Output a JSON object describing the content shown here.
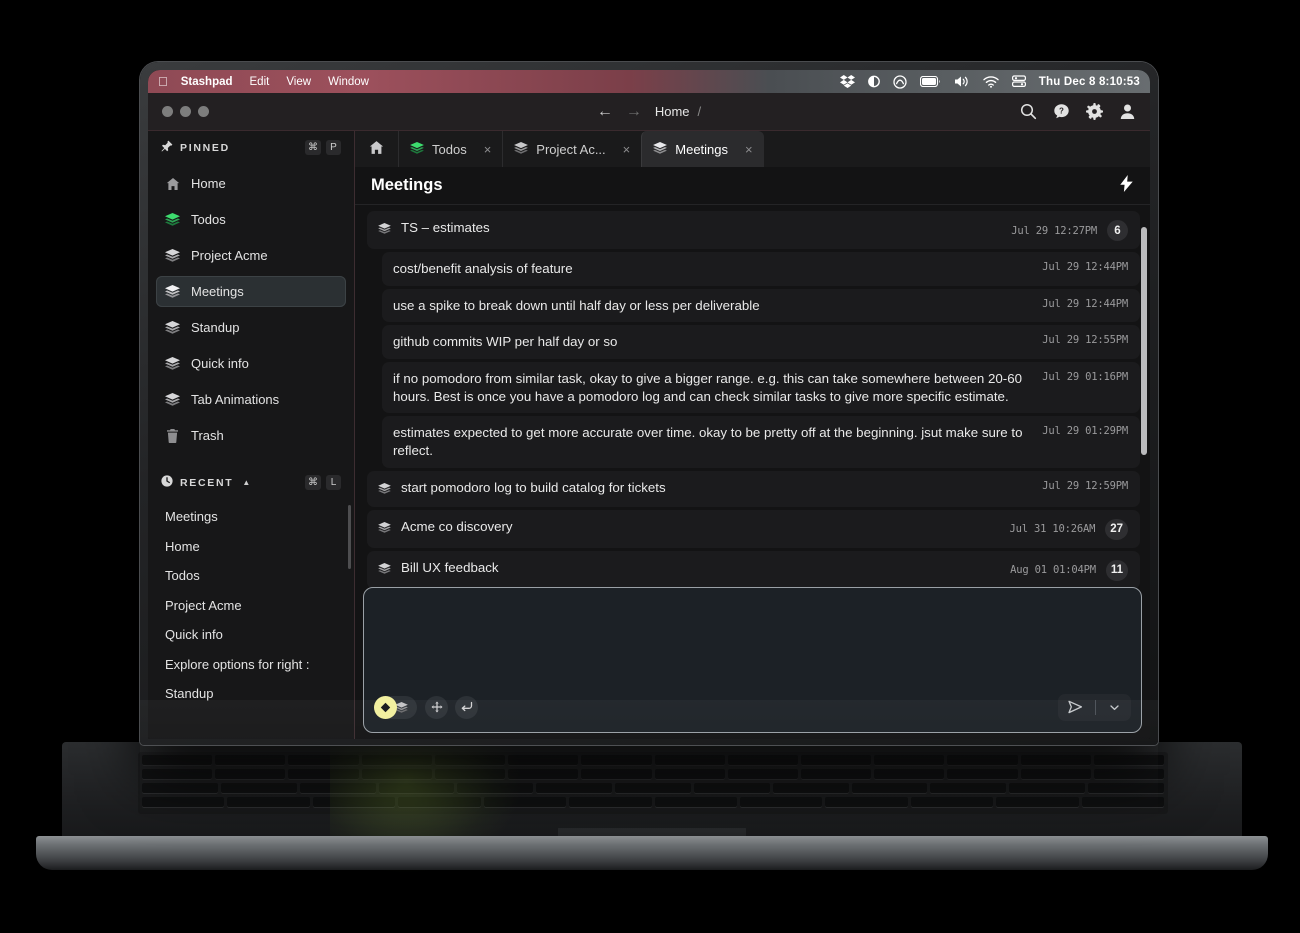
{
  "menubar": {
    "apple": "apple-logo",
    "items": [
      "Stashpad",
      "Edit",
      "View",
      "Window"
    ],
    "status_icons": [
      "dropbox-icon",
      "contrast-icon",
      "clock-circle-icon",
      "battery-icon",
      "volume-icon",
      "wifi-icon",
      "control-center-icon"
    ],
    "clock": "Thu Dec 8  8:10:53"
  },
  "titlebar": {
    "back": "←",
    "forward": "→",
    "breadcrumb": "Home",
    "breadcrumb_sep": "/",
    "actions": [
      "search-icon",
      "help-icon",
      "gear-icon",
      "account-icon"
    ]
  },
  "sidebar": {
    "pinned": {
      "title": "PINNED",
      "shortcut": [
        "⌘",
        "P"
      ],
      "items": [
        {
          "label": "Home",
          "icon": "home-icon"
        },
        {
          "label": "Todos",
          "icon": "stack-icon-green"
        },
        {
          "label": "Project Acme",
          "icon": "stack-icon"
        },
        {
          "label": "Meetings",
          "icon": "stack-icon"
        },
        {
          "label": "Standup",
          "icon": "stack-icon"
        },
        {
          "label": "Quick info",
          "icon": "stack-icon"
        },
        {
          "label": "Tab Animations",
          "icon": "stack-icon"
        },
        {
          "label": "Trash",
          "icon": "trash-icon"
        }
      ],
      "active": "Meetings"
    },
    "recent": {
      "title": "RECENT",
      "caret": "▲",
      "shortcut": [
        "⌘",
        "L"
      ],
      "items": [
        "Meetings",
        "Home",
        "Todos",
        "Project Acme",
        "Quick info",
        "Explore options for right :",
        "Standup"
      ]
    }
  },
  "tabs": [
    {
      "label": "",
      "icon": "home-icon",
      "closable": false,
      "active": false
    },
    {
      "label": "Todos",
      "icon": "stack-icon-green",
      "close": "×",
      "active": false
    },
    {
      "label": "Project Ac...",
      "icon": "stack-icon",
      "close": "×",
      "active": false
    },
    {
      "label": "Meetings",
      "icon": "stack-icon",
      "close": "×",
      "active": true
    }
  ],
  "page": {
    "title": "Meetings",
    "action_icon": "lightning-bolt-icon"
  },
  "notes": [
    {
      "text": "TS – estimates",
      "time": "Jul 29 12:27PM",
      "badge": "6",
      "icon": "stack-icon",
      "child": false
    },
    {
      "text": "cost/benefit analysis of feature",
      "time": "Jul 29 12:44PM",
      "badge": "",
      "icon": "",
      "child": true
    },
    {
      "text": "use a spike to break down until half day or less per deliverable",
      "time": "Jul 29 12:44PM",
      "badge": "",
      "icon": "",
      "child": true
    },
    {
      "text": "github commits WIP per half day or so",
      "time": "Jul 29 12:55PM",
      "badge": "",
      "icon": "",
      "child": true
    },
    {
      "text": "if no pomodoro from similar task, okay to give a bigger range. e.g. this can take somewhere between 20-60 hours. Best is once you have a pomodoro log and can check similar tasks to give more specific estimate.",
      "time": "Jul 29 01:16PM",
      "badge": "",
      "icon": "",
      "child": true
    },
    {
      "text": "estimates expected to get more accurate over time. okay to be pretty off at the beginning. jsut make sure to reflect.",
      "time": "Jul 29 01:29PM",
      "badge": "",
      "icon": "",
      "child": true
    },
    {
      "text": "start pomodoro log to build catalog for tickets",
      "time": "Jul 29 12:59PM",
      "badge": "",
      "icon": "stack-icon",
      "child": false
    },
    {
      "text": "Acme co discovery",
      "time": "Jul 31 10:26AM",
      "badge": "27",
      "icon": "stack-icon",
      "child": false
    },
    {
      "text": "Bill UX feedback",
      "time": "Aug 01 01:04PM",
      "badge": "11",
      "icon": "stack-icon",
      "child": false
    }
  ],
  "composer": {
    "value": "",
    "placeholder": "",
    "buttons": [
      "diamond-icon",
      "stack-icon",
      "move-icon",
      "return-icon"
    ],
    "send": "send-icon",
    "send_dropdown": "chevron-down-icon"
  }
}
